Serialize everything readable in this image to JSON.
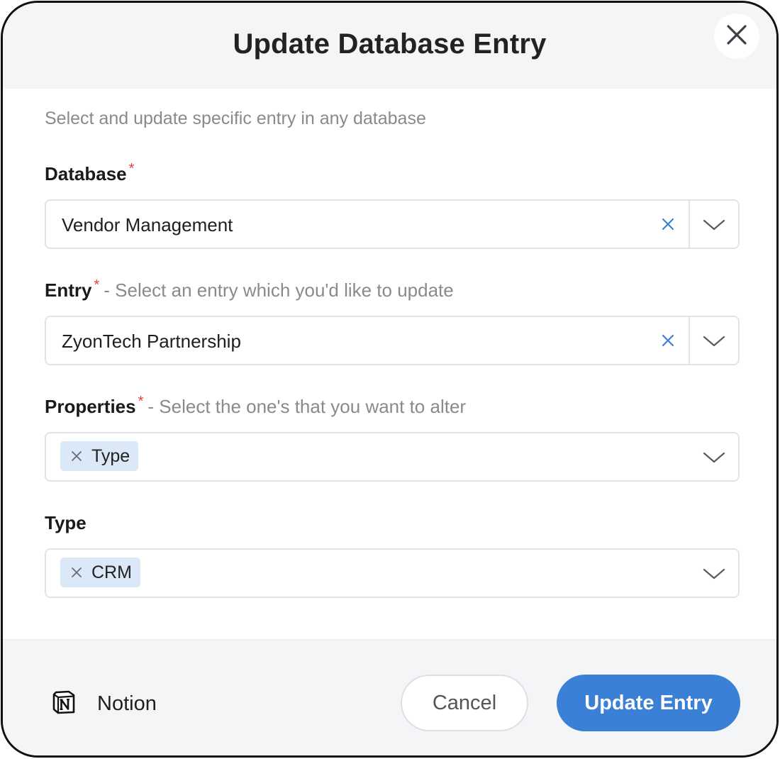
{
  "dialog": {
    "title": "Update Database Entry",
    "subtitle": "Select and update specific entry in any database",
    "close_icon": "close-icon"
  },
  "fields": {
    "database": {
      "label": "Database",
      "required_mark": "*",
      "value": "Vendor Management"
    },
    "entry": {
      "label": "Entry",
      "required_mark": "*",
      "hint": "-  Select an entry which you'd like to update",
      "value": "ZyonTech Partnership"
    },
    "properties": {
      "label": "Properties",
      "required_mark": "*",
      "hint": "-  Select the one's that you want to alter",
      "tags": [
        "Type"
      ]
    },
    "type": {
      "label": "Type",
      "tags": [
        "CRM"
      ]
    }
  },
  "footer": {
    "brand_name": "Notion",
    "brand_icon": "notion-logo-icon",
    "cancel_label": "Cancel",
    "update_label": "Update Entry"
  },
  "colors": {
    "accent": "#3a80d6",
    "required": "#e0413b",
    "tag_bg": "#dbe8f7",
    "header_bg": "#f4f5f7"
  }
}
